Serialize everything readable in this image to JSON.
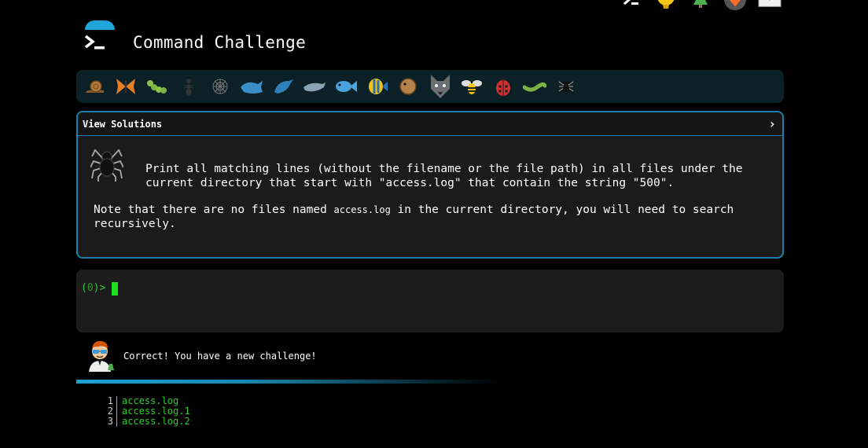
{
  "header": {
    "title": "Command Challenge"
  },
  "topbar_icons": [
    "terminal-icon",
    "lightbulb-icon",
    "tree-icon",
    "gitlab-icon",
    "mail-icon"
  ],
  "animals": [
    "snail",
    "butterfly",
    "caterpillar",
    "ant",
    "spider-web",
    "whale",
    "dolphin",
    "dolphin-grey",
    "fish",
    "tropical-fish",
    "blowfish",
    "wolf",
    "bee",
    "ladybug",
    "worm",
    "spider"
  ],
  "panel": {
    "header_label": "View Solutions",
    "question": "Print all matching lines (without the filename or the file path) in all files under the current directory that start with \"access.log\" that contain the string \"500\".",
    "note_prefix": "Note that there are no files named ",
    "note_code": "access.log",
    "note_suffix": " in the current directory, you will need to search recursively."
  },
  "terminal": {
    "prompt_open": "(",
    "prompt_count": "0",
    "prompt_close": ")>"
  },
  "feedback": {
    "message": "Correct! You have a new challenge!"
  },
  "output": {
    "lines": [
      {
        "n": "1",
        "text": "access.log"
      },
      {
        "n": "2",
        "text": "access.log.1"
      },
      {
        "n": "3",
        "text": "access.log.2"
      }
    ]
  },
  "colors": {
    "accent": "#1b7fa8",
    "prompt_green": "#2ecc2e",
    "background": "#000000"
  }
}
